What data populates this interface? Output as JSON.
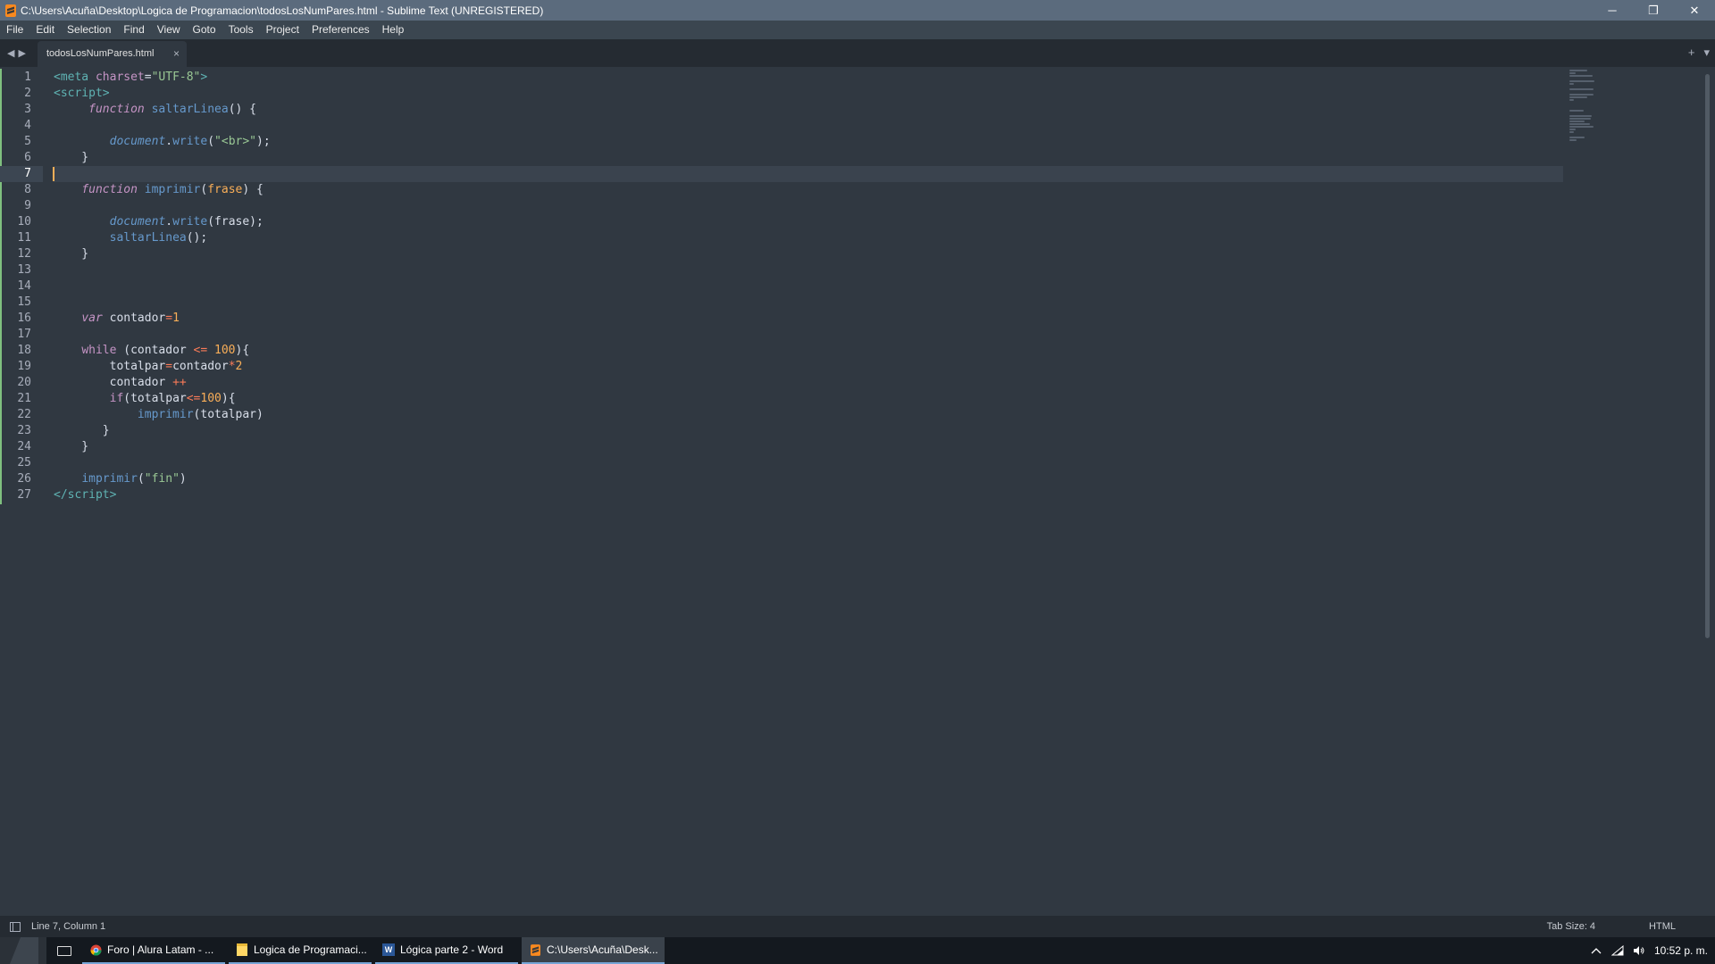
{
  "window": {
    "title": "C:\\Users\\Acuña\\Desktop\\Logica de Programacion\\todosLosNumPares.html - Sublime Text (UNREGISTERED)",
    "controls": {
      "minimize": "─",
      "restore": "❐",
      "close": "✕"
    }
  },
  "menu": [
    "File",
    "Edit",
    "Selection",
    "Find",
    "View",
    "Goto",
    "Tools",
    "Project",
    "Preferences",
    "Help"
  ],
  "tabs": [
    {
      "label": "todosLosNumPares.html",
      "close": "×"
    }
  ],
  "tab_actions": {
    "add": "+",
    "dropdown": "▾"
  },
  "editor": {
    "active_line": 7,
    "lines": [
      [
        [
          "tag",
          "<"
        ],
        [
          "tag",
          "meta"
        ],
        [
          "plain",
          " "
        ],
        [
          "attr",
          "charset"
        ],
        [
          "plain",
          "="
        ],
        [
          "str",
          "\"UTF-8\""
        ],
        [
          "tag",
          ">"
        ]
      ],
      [
        [
          "tag",
          "<"
        ],
        [
          "tag",
          "script"
        ],
        [
          "tag",
          ">"
        ]
      ],
      [
        [
          "plain",
          "     "
        ],
        [
          "kw",
          "function"
        ],
        [
          "plain",
          " "
        ],
        [
          "fn",
          "saltarLinea"
        ],
        [
          "plain",
          "() {"
        ]
      ],
      [],
      [
        [
          "plain",
          "        "
        ],
        [
          "obj",
          "document"
        ],
        [
          "plain",
          "."
        ],
        [
          "fn",
          "write"
        ],
        [
          "plain",
          "("
        ],
        [
          "str",
          "\"<br>\""
        ],
        [
          "plain",
          ");"
        ]
      ],
      [
        [
          "plain",
          "    }"
        ]
      ],
      [],
      [
        [
          "plain",
          "    "
        ],
        [
          "kw",
          "function"
        ],
        [
          "plain",
          " "
        ],
        [
          "fn",
          "imprimir"
        ],
        [
          "plain",
          "("
        ],
        [
          "param",
          "frase"
        ],
        [
          "plain",
          ") {"
        ]
      ],
      [],
      [
        [
          "plain",
          "        "
        ],
        [
          "obj",
          "document"
        ],
        [
          "plain",
          "."
        ],
        [
          "fn",
          "write"
        ],
        [
          "plain",
          "(frase);"
        ]
      ],
      [
        [
          "plain",
          "        "
        ],
        [
          "fn",
          "saltarLinea"
        ],
        [
          "plain",
          "();"
        ]
      ],
      [
        [
          "plain",
          "    }"
        ]
      ],
      [],
      [],
      [],
      [
        [
          "plain",
          "    "
        ],
        [
          "kw",
          "var"
        ],
        [
          "plain",
          " contador"
        ],
        [
          "op",
          "="
        ],
        [
          "num",
          "1"
        ]
      ],
      [],
      [
        [
          "plain",
          "    "
        ],
        [
          "ctl",
          "while"
        ],
        [
          "plain",
          " (contador "
        ],
        [
          "op",
          "<="
        ],
        [
          "plain",
          " "
        ],
        [
          "num",
          "100"
        ],
        [
          "plain",
          "){"
        ]
      ],
      [
        [
          "plain",
          "        totalpar"
        ],
        [
          "op",
          "="
        ],
        [
          "plain",
          "contador"
        ],
        [
          "op",
          "*"
        ],
        [
          "num",
          "2"
        ]
      ],
      [
        [
          "plain",
          "        contador "
        ],
        [
          "op",
          "++"
        ]
      ],
      [
        [
          "plain",
          "        "
        ],
        [
          "ctl",
          "if"
        ],
        [
          "plain",
          "(totalpar"
        ],
        [
          "op",
          "<="
        ],
        [
          "num",
          "100"
        ],
        [
          "plain",
          "){"
        ]
      ],
      [
        [
          "plain",
          "            "
        ],
        [
          "fn",
          "imprimir"
        ],
        [
          "plain",
          "(totalpar)"
        ]
      ],
      [
        [
          "plain",
          "       }"
        ]
      ],
      [
        [
          "plain",
          "    }"
        ]
      ],
      [],
      [
        [
          "plain",
          "    "
        ],
        [
          "fn",
          "imprimir"
        ],
        [
          "plain",
          "("
        ],
        [
          "str",
          "\"fin\""
        ],
        [
          "plain",
          ")"
        ]
      ],
      [
        [
          "tag",
          "</"
        ],
        [
          "tag",
          "script"
        ],
        [
          "tag",
          ">"
        ]
      ]
    ]
  },
  "status": {
    "position": "Line 7, Column 1",
    "tab_size": "Tab Size: 4",
    "syntax": "HTML"
  },
  "taskbar": {
    "items": [
      {
        "label": "Foro | Alura Latam - ...",
        "icon": "chrome-icon",
        "active": false
      },
      {
        "label": "Logica de Programaci...",
        "icon": "folder-icon",
        "active": false
      },
      {
        "label": "Lógica parte 2 - Word",
        "icon": "word-icon",
        "active": false
      },
      {
        "label": "C:\\Users\\Acuña\\Desk...",
        "icon": "sublime-icon",
        "active": true
      }
    ],
    "clock": "10:52 p. m."
  },
  "colors": {
    "background": "#303841",
    "titlebar": "#5b6b7d",
    "caret": "#f9ae58",
    "modified_marker": "#7fc07f"
  }
}
